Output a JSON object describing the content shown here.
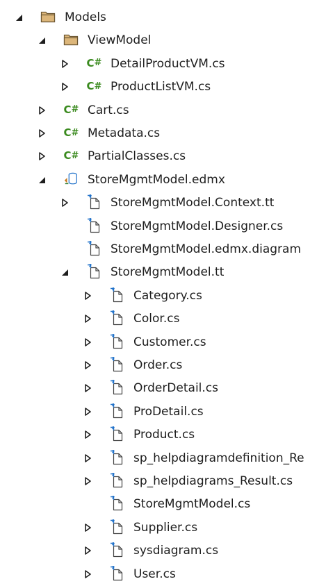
{
  "colors": {
    "background": "#ffffff",
    "text": "#1e1e1e",
    "folder_fill": "#dcb67a",
    "folder_stroke": "#6b5632",
    "csharp_green": "#3a8a1e",
    "file_blue": "#1e70c9"
  },
  "csharp_glyph": "C",
  "csharp_hash": "#",
  "tree": [
    {
      "label": "Models",
      "icon": "folder-icon",
      "depth": 0,
      "chevron": "expanded"
    },
    {
      "label": "ViewModel",
      "icon": "folder-icon",
      "depth": 1,
      "chevron": "expanded"
    },
    {
      "label": "DetailProductVM.cs",
      "icon": "csharp-file-icon",
      "depth": 2,
      "chevron": "collapsed"
    },
    {
      "label": "ProductListVM.cs",
      "icon": "csharp-file-icon",
      "depth": 2,
      "chevron": "collapsed"
    },
    {
      "label": "Cart.cs",
      "icon": "csharp-file-icon",
      "depth": 1,
      "chevron": "collapsed"
    },
    {
      "label": "Metadata.cs",
      "icon": "csharp-file-icon",
      "depth": 1,
      "chevron": "collapsed"
    },
    {
      "label": "PartialClasses.cs",
      "icon": "csharp-file-icon",
      "depth": 1,
      "chevron": "collapsed"
    },
    {
      "label": "StoreMgmtModel.edmx",
      "icon": "edmx-database-icon",
      "depth": 1,
      "chevron": "expanded"
    },
    {
      "label": "StoreMgmtModel.Context.tt",
      "icon": "generated-file-icon",
      "depth": 2,
      "chevron": "collapsed"
    },
    {
      "label": "StoreMgmtModel.Designer.cs",
      "icon": "generated-file-icon",
      "depth": 2,
      "chevron": "none"
    },
    {
      "label": "StoreMgmtModel.edmx.diagram",
      "icon": "generated-file-icon",
      "depth": 2,
      "chevron": "none"
    },
    {
      "label": "StoreMgmtModel.tt",
      "icon": "generated-file-icon",
      "depth": 2,
      "chevron": "expanded"
    },
    {
      "label": "Category.cs",
      "icon": "generated-file-icon",
      "depth": 3,
      "chevron": "collapsed"
    },
    {
      "label": "Color.cs",
      "icon": "generated-file-icon",
      "depth": 3,
      "chevron": "collapsed"
    },
    {
      "label": "Customer.cs",
      "icon": "generated-file-icon",
      "depth": 3,
      "chevron": "collapsed"
    },
    {
      "label": "Order.cs",
      "icon": "generated-file-icon",
      "depth": 3,
      "chevron": "collapsed"
    },
    {
      "label": "OrderDetail.cs",
      "icon": "generated-file-icon",
      "depth": 3,
      "chevron": "collapsed"
    },
    {
      "label": "ProDetail.cs",
      "icon": "generated-file-icon",
      "depth": 3,
      "chevron": "collapsed"
    },
    {
      "label": "Product.cs",
      "icon": "generated-file-icon",
      "depth": 3,
      "chevron": "collapsed"
    },
    {
      "label": "sp_helpdiagramdefinition_Re",
      "icon": "generated-file-icon",
      "depth": 3,
      "chevron": "collapsed"
    },
    {
      "label": "sp_helpdiagrams_Result.cs",
      "icon": "generated-file-icon",
      "depth": 3,
      "chevron": "collapsed"
    },
    {
      "label": "StoreMgmtModel.cs",
      "icon": "generated-file-icon",
      "depth": 3,
      "chevron": "none"
    },
    {
      "label": "Supplier.cs",
      "icon": "generated-file-icon",
      "depth": 3,
      "chevron": "collapsed"
    },
    {
      "label": "sysdiagram.cs",
      "icon": "generated-file-icon",
      "depth": 3,
      "chevron": "collapsed"
    },
    {
      "label": "User.cs",
      "icon": "generated-file-icon",
      "depth": 3,
      "chevron": "collapsed"
    }
  ]
}
